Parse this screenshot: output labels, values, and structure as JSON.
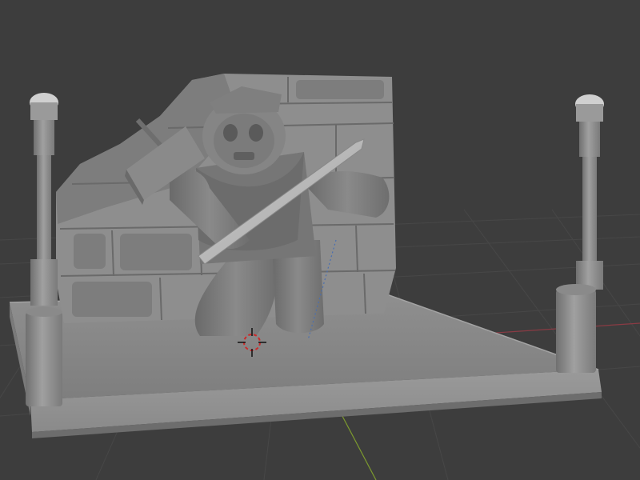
{
  "viewport": {
    "kind": "3d-viewport",
    "shading": "solid",
    "background_color": "#3d3d3d",
    "grid_line_color": "#484848",
    "x_axis_color": "#8a3b44",
    "y_axis_color": "#7c9a2e",
    "z_axis_color": "#4a6fb0",
    "cursor_color": "#cc2a2a"
  },
  "scene": {
    "objects": [
      {
        "name": "base-plinth",
        "color": "#8c8c8c"
      },
      {
        "name": "brick-wall",
        "color": "#8e8e8e"
      },
      {
        "name": "robot-warrior",
        "color": "#7a7a7a"
      },
      {
        "name": "sword",
        "color": "#a8a8a8"
      },
      {
        "name": "lamp-post-left",
        "color": "#8c8c8c"
      },
      {
        "name": "lamp-post-right",
        "color": "#8c8c8c"
      }
    ]
  }
}
